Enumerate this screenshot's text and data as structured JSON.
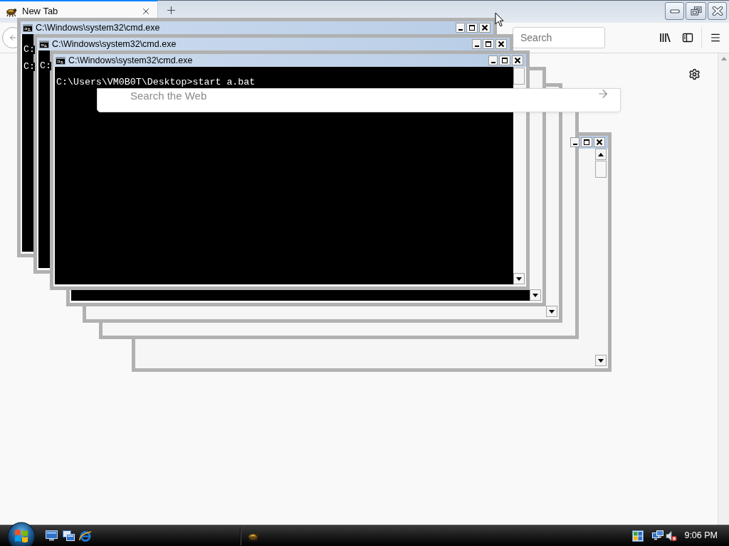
{
  "browser": {
    "tabs": [
      {
        "label": "New Tab",
        "selected": true
      }
    ],
    "toolbar": {
      "search": {
        "placeholder": "Search"
      }
    },
    "page": {
      "search": {
        "placeholder": "Search the Web"
      }
    }
  },
  "console_windows": [
    {
      "title": "C:\\Windows\\system32\\cmd.exe",
      "kind": "console",
      "lines": [
        "C:",
        "C:"
      ]
    },
    {
      "title": "C:\\Windows\\system32\\cmd.exe",
      "kind": "console",
      "lines": [
        "C:"
      ]
    },
    {
      "title": "C:\\Windows\\system32\\cmd.exe",
      "kind": "console",
      "lines": [
        "C:\\Users\\VM0B0T\\Desktop>start a.bat"
      ]
    },
    {
      "kind": "console"
    },
    {
      "kind": "blank"
    },
    {
      "kind": "blank"
    },
    {
      "kind": "blank"
    }
  ],
  "taskbar": {
    "clock": "9:06 PM"
  }
}
